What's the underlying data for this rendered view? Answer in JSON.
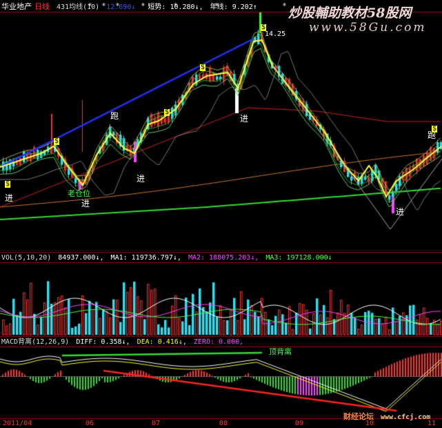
{
  "header_main": {
    "stock": "华业地产",
    "period": "日线",
    "ma_label": "431均线(10)",
    "ma_value": "12.690↓",
    "short_label": "短势: 10.280↓,",
    "year_label": "年线: 9.202↑",
    "colors": {
      "stock": "#ffffff",
      "period": "#ff3333",
      "ma": "#ffffff",
      "ma_value": "#3355ff",
      "short": "#ffffff",
      "year": "#ffffff"
    }
  },
  "watermark": {
    "title": "炒股輔助教材58股网",
    "url": "www.58Gu.com"
  },
  "annotations": {
    "peak_price": "14.25",
    "jin": "进",
    "pao": "跑",
    "laojincang": "老仓位",
    "top_divergence": "顶背离"
  },
  "header_vol": {
    "label": "VOL(5,10,20)",
    "vol": "84937.000↓,",
    "ma1": "MA1: 119736.797↓,",
    "ma2": "MA2: 188075.203↓,",
    "ma3": "MA3: 197128.000↓"
  },
  "header_macd": {
    "label": "MACD背离(12,26,9)",
    "diff": "DIFF: 0.358↓,",
    "dea": "DEA: 0.416↓,",
    "zero": "ZERO: 0.000,"
  },
  "x_axis": {
    "labels": [
      "2011/04",
      "06",
      "07",
      "08",
      "09",
      "10",
      "11"
    ]
  },
  "footer_site": {
    "left": "财经论坛",
    "right": "www.cfcj.com"
  },
  "chart_data": {
    "type": "candlestick",
    "price_range": [
      6.5,
      15.0
    ],
    "trend_line_peak": 14.25
  }
}
